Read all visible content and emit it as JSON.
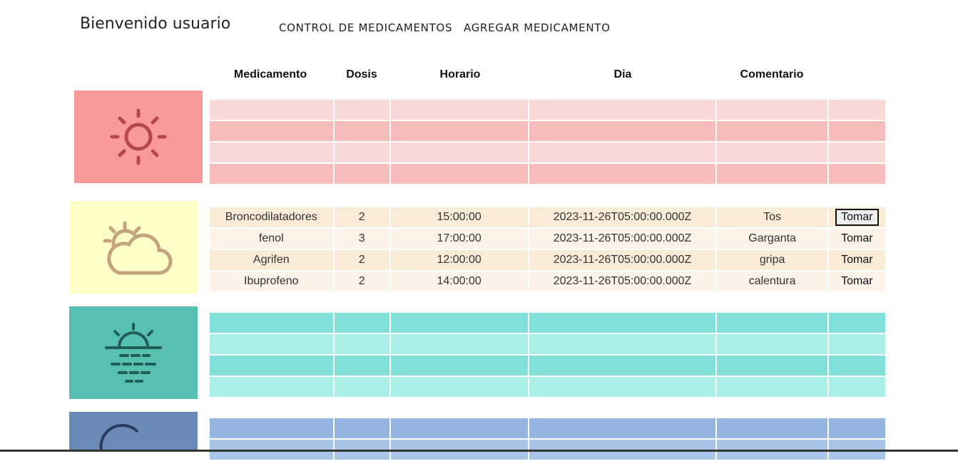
{
  "header": {
    "welcome": "Bienvenido usuario",
    "nav": [
      "CONTROL DE MEDICAMENTOS",
      "AGREGAR MEDICAMENTO"
    ]
  },
  "columns": [
    "Medicamento",
    "Dosis",
    "Horario",
    "Dia",
    "Comentario"
  ],
  "sections": [
    {
      "name": "morning",
      "icon": "sun-icon",
      "panel_color": "#f99a9a",
      "row_colors": [
        "#f9d8d8",
        "#f6bcbc"
      ],
      "rows": [
        {
          "medicamento": "",
          "dosis": "",
          "horario": "",
          "dia": "",
          "comentario": "",
          "action": ""
        },
        {
          "medicamento": "",
          "dosis": "",
          "horario": "",
          "dia": "",
          "comentario": "",
          "action": ""
        },
        {
          "medicamento": "",
          "dosis": "",
          "horario": "",
          "dia": "",
          "comentario": "",
          "action": ""
        },
        {
          "medicamento": "",
          "dosis": "",
          "horario": "",
          "dia": "",
          "comentario": "",
          "action": ""
        }
      ]
    },
    {
      "name": "afternoon",
      "icon": "partly-cloudy-icon",
      "panel_color": "#ffffc8",
      "row_colors": [
        "#faebd7",
        "#fcf2e8"
      ],
      "rows": [
        {
          "medicamento": "Broncodilatadores",
          "dosis": "2",
          "horario": "15:00:00",
          "dia": "2023-11-26T05:00:00.000Z",
          "comentario": "Tos",
          "action": "Tomar"
        },
        {
          "medicamento": "fenol",
          "dosis": "3",
          "horario": "17:00:00",
          "dia": "2023-11-26T05:00:00.000Z",
          "comentario": "Garganta",
          "action": "Tomar"
        },
        {
          "medicamento": "Agrifen",
          "dosis": "2",
          "horario": "12:00:00",
          "dia": "2023-11-26T05:00:00.000Z",
          "comentario": "gripa",
          "action": "Tomar"
        },
        {
          "medicamento": "Ibuprofeno",
          "dosis": "2",
          "horario": "14:00:00",
          "dia": "2023-11-26T05:00:00.000Z",
          "comentario": "calentura",
          "action": "Tomar"
        }
      ]
    },
    {
      "name": "evening",
      "icon": "sunset-icon",
      "panel_color": "#57c0b0",
      "row_colors": [
        "#82e0db",
        "#aaf0e8"
      ],
      "rows": [
        {
          "medicamento": "",
          "dosis": "",
          "horario": "",
          "dia": "",
          "comentario": "",
          "action": ""
        },
        {
          "medicamento": "",
          "dosis": "",
          "horario": "",
          "dia": "",
          "comentario": "",
          "action": ""
        },
        {
          "medicamento": "",
          "dosis": "",
          "horario": "",
          "dia": "",
          "comentario": "",
          "action": ""
        },
        {
          "medicamento": "",
          "dosis": "",
          "horario": "",
          "dia": "",
          "comentario": "",
          "action": ""
        }
      ]
    },
    {
      "name": "night",
      "icon": "moon-icon",
      "panel_color": "#6a8ab8",
      "row_colors": [
        "#96b4e0",
        "#a8c4e8"
      ],
      "rows": [
        {
          "medicamento": "",
          "dosis": "",
          "horario": "",
          "dia": "",
          "comentario": "",
          "action": ""
        },
        {
          "medicamento": "",
          "dosis": "",
          "horario": "",
          "dia": "",
          "comentario": "",
          "action": ""
        }
      ]
    }
  ]
}
